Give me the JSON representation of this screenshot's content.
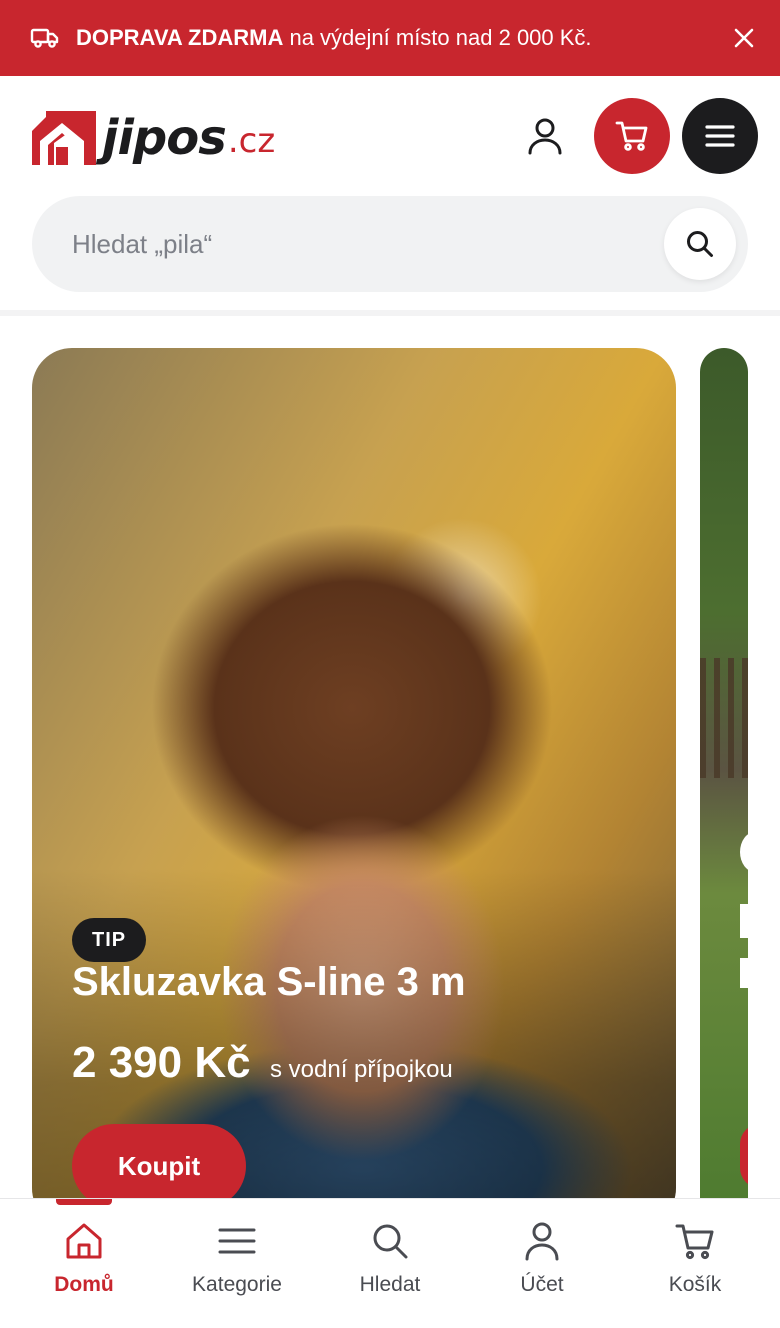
{
  "promo": {
    "bold_text": "DOPRAVA ZDARMA",
    "rest_text": " na výdejní místo nad 2 000 Kč.",
    "truck_icon": "truck-icon",
    "close_icon": "close-icon"
  },
  "header": {
    "logo_name": "jipos",
    "logo_tld": ".cz",
    "account_icon": "user-icon",
    "cart_icon": "cart-icon",
    "menu_icon": "hamburger-icon"
  },
  "search": {
    "placeholder": "Hledat „pila“",
    "button_icon": "search-icon"
  },
  "slides": [
    {
      "badge": "TIP",
      "title": "Skluzavka S-line 3 m",
      "price": "2 390 Kč",
      "note": "s vodní přípojkou",
      "button_label": "Koupit"
    }
  ],
  "bottom_nav": {
    "items": [
      {
        "label": "Domů",
        "icon": "home-icon",
        "active": true
      },
      {
        "label": "Kategorie",
        "icon": "list-icon",
        "active": false
      },
      {
        "label": "Hledat",
        "icon": "search-icon",
        "active": false
      },
      {
        "label": "Účet",
        "icon": "user-icon",
        "active": false
      },
      {
        "label": "Košík",
        "icon": "cart-icon",
        "active": false
      }
    ]
  },
  "colors": {
    "brand_red": "#c8262e",
    "dark": "#1c1c1e",
    "search_bg": "#f1f2f3"
  }
}
